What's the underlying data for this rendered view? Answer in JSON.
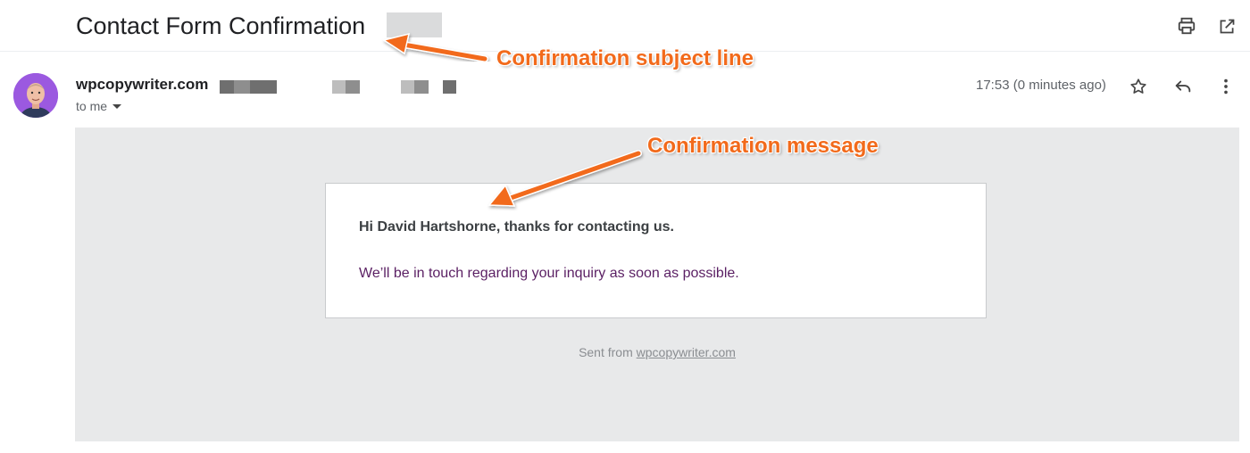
{
  "subject": {
    "title": "Contact Form Confirmation"
  },
  "toolbar": {
    "print_icon": "print-icon",
    "open_new_window_icon": "open-in-new-window-icon"
  },
  "sender": {
    "name": "wpcopywriter.com",
    "recipient_label": "to me",
    "timestamp": "17:53 (0 minutes ago)",
    "actions": {
      "star_icon": "star-icon",
      "reply_icon": "reply-icon",
      "more_icon": "more-vertical-icon"
    }
  },
  "email_body": {
    "greeting": "Hi David Hartshorne, thanks for contacting us.",
    "message": "We’ll be in touch regarding your inquiry as soon as possible.",
    "sent_from_prefix": "Sent from ",
    "sent_from_link": "wpcopywriter.com"
  },
  "annotations": {
    "subject_callout": "Confirmation subject line",
    "message_callout": "Confirmation message"
  },
  "colors": {
    "annotation": "#f26a1b",
    "message_text": "#5a1f63",
    "panel_background": "#e8e9ea",
    "avatar_background": "#9b59e0"
  }
}
